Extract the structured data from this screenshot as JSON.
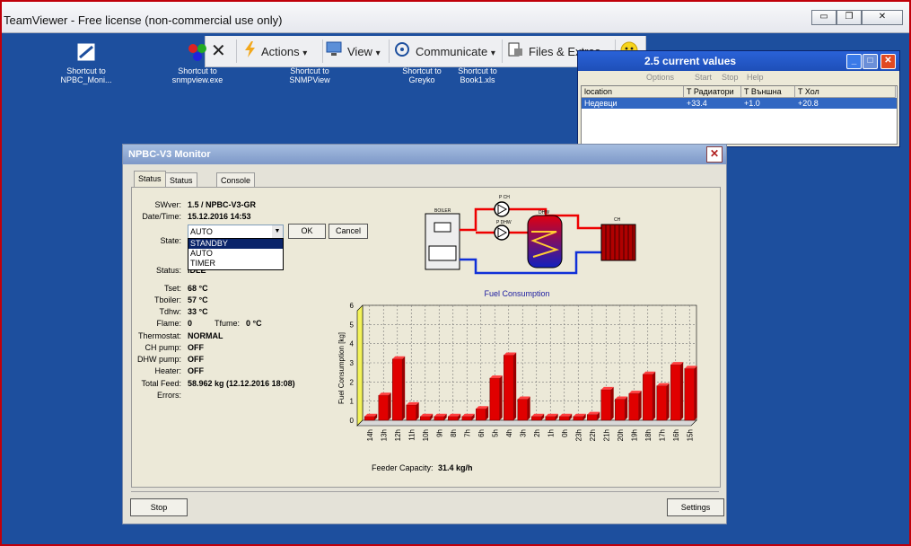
{
  "teamviewer": {
    "title": "TeamViewer - Free license (non-commercial use only)",
    "minimize": "▭",
    "restore": "❐",
    "close": "✕",
    "toolbar": {
      "close_icon": "✕",
      "actions": "Actions",
      "view": "View",
      "communicate": "Communicate",
      "files": "Files & Extras",
      "caret": "▾"
    }
  },
  "desktop": {
    "icons": [
      {
        "label_line1": "Shortcut to",
        "label_line2": "NPBC_Moni..."
      },
      {
        "label_line1": "Shortcut to",
        "label_line2": "snmpview.exe"
      },
      {
        "label_line1": "Shortcut to",
        "label_line2": "SNMPView"
      },
      {
        "label_line1": "Shortcut to",
        "label_line2": "Greyko"
      },
      {
        "label_line1": "Shortcut to",
        "label_line2": "Book1.xls"
      }
    ]
  },
  "values_window": {
    "title": "2.5  current values",
    "menu": [
      "Options",
      "Start",
      "Stop",
      "Help"
    ],
    "columns": [
      "location",
      "T Радиатори",
      "T Външна",
      "T Хол"
    ],
    "rows": [
      [
        "Недевци",
        "+33.4",
        "+1.0",
        "+20.8"
      ]
    ]
  },
  "monitor": {
    "title": "NPBC-V3 Monitor",
    "close": "✕",
    "tabs": [
      "Status",
      "Status Chart",
      "Console"
    ],
    "labels": {
      "swver": "SWver:",
      "datetime": "Date/Time:",
      "state": "State:",
      "status": "Status:",
      "tset": "Tset:",
      "tboiler": "Tboiler:",
      "tdhw": "Tdhw:",
      "flame": "Flame:",
      "tfume": "Tfume:",
      "thermostat": "Thermostat:",
      "ch_pump": "CH pump:",
      "dhw_pump": "DHW pump:",
      "heater": "Heater:",
      "total_feed": "Total Feed:",
      "errors": "Errors:"
    },
    "values": {
      "swver": "1.5 / NPBC-V3-GR",
      "datetime": "15.12.2016 14:53",
      "status": "IDLE",
      "tset": "68 °C",
      "tboiler": "57 °C",
      "tdhw": "33 °C",
      "flame": "0",
      "tfume": "0 °C",
      "thermostat": "NORMAL",
      "ch_pump": "OFF",
      "dhw_pump": "OFF",
      "heater": "OFF",
      "total_feed": "58.962 kg (12.12.2016 18:08)"
    },
    "state_select": {
      "value": "AUTO",
      "options": [
        "STANDBY",
        "AUTO",
        "TIMER"
      ],
      "highlighted": "STANDBY"
    },
    "ok": "OK",
    "cancel": "Cancel",
    "diagram": {
      "boiler": "BOILER",
      "ch": "CH",
      "dhw": "DHW",
      "pch": "P CH",
      "pdhw": "P DHW"
    },
    "feeder_label": "Feeder Capacity:",
    "feeder_value": "31.4 kg/h",
    "stop": "Stop",
    "settings": "Settings"
  },
  "chart_data": {
    "type": "bar",
    "title": "Fuel Consumption",
    "ylabel": "Fuel Consumption [kg]",
    "xlabel": "",
    "ylim": [
      0,
      6
    ],
    "yticks": [
      0,
      1,
      2,
      3,
      4,
      5,
      6
    ],
    "categories": [
      "14h",
      "13h",
      "12h",
      "11h",
      "10h",
      "9h",
      "8h",
      "7h",
      "6h",
      "5h",
      "4h",
      "3h",
      "2h",
      "1h",
      "0h",
      "23h",
      "22h",
      "21h",
      "20h",
      "19h",
      "18h",
      "17h",
      "16h",
      "15h"
    ],
    "values": [
      0.2,
      1.3,
      3.2,
      0.8,
      0.2,
      0.2,
      0.2,
      0.2,
      0.6,
      2.2,
      3.4,
      1.1,
      0.2,
      0.2,
      0.2,
      0.2,
      0.3,
      1.6,
      1.1,
      1.4,
      2.4,
      1.8,
      2.9,
      2.7
    ],
    "bar_color": "#e00000",
    "grid": true
  }
}
